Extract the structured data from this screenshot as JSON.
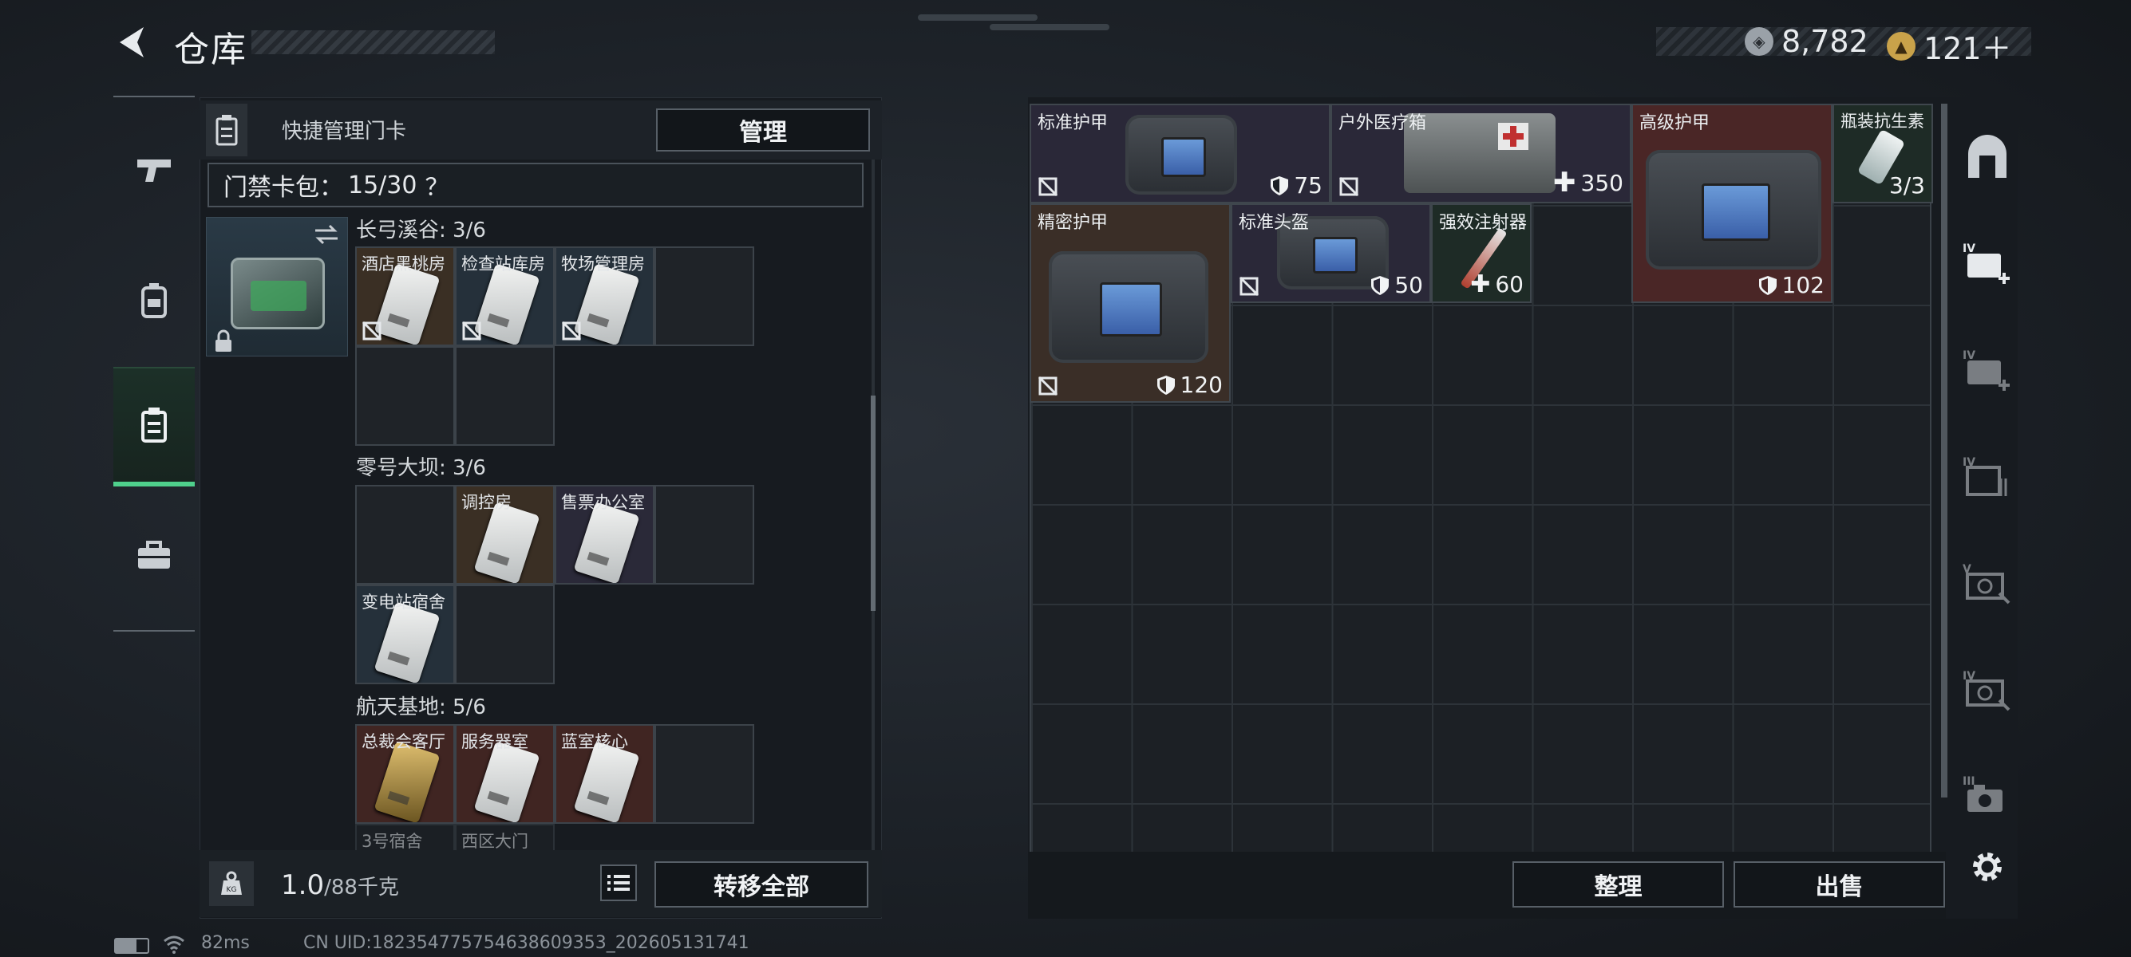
{
  "header": {
    "title": "仓库"
  },
  "currency": [
    {
      "icon": "silver-coin-icon",
      "value": "8,782"
    },
    {
      "icon": "gold-coin-icon",
      "value": "121＋"
    }
  ],
  "nav": {
    "items": [
      "weapon",
      "equipment",
      "keycard",
      "toolbox"
    ],
    "active": "keycard"
  },
  "quick_manage": {
    "label": "快捷管理门卡",
    "button": "管理"
  },
  "card_pack": {
    "label": "门禁卡包：",
    "count": "15/30",
    "help": "？"
  },
  "sections": [
    {
      "title": "长弓溪谷: 3/6",
      "cards": [
        "酒店黑桃房",
        "检查站库房",
        "牧场管理房"
      ]
    },
    {
      "title": "零号大坝: 3/6",
      "cards": [
        "调控房",
        "售票办公室",
        "变电站宿舍"
      ]
    },
    {
      "title": "航天基地: 5/6",
      "cards": [
        "总裁会客厅",
        "服务器室",
        "蓝室核心",
        "3号宿舍",
        "西区大门"
      ]
    }
  ],
  "weight": {
    "current": "1.0",
    "max": "/88千克"
  },
  "transfer_all": "转移全部",
  "items": [
    {
      "name": "标准护甲",
      "value": "75",
      "type": "armor"
    },
    {
      "name": "户外医疗箱",
      "value": "350",
      "type": "heal"
    },
    {
      "name": "高级护甲",
      "value": "102",
      "type": "armor"
    },
    {
      "name": "瓶装抗生素",
      "value": "3/3",
      "type": "stack"
    },
    {
      "name": "精密护甲",
      "value": "120",
      "type": "armor"
    },
    {
      "name": "标准头盔",
      "value": "50",
      "type": "armor"
    },
    {
      "name": "强效注射器",
      "value": "60",
      "type": "heal"
    }
  ],
  "actions": {
    "sort": "整理",
    "sell": "出售"
  },
  "status": {
    "ping": "82ms",
    "uid": "CN UID:1823547757546386093​53_202605131741"
  },
  "colors": {
    "accent_green": "#4fd08c",
    "armor_tint": "#3a2e27",
    "red_tint": "#4a2626"
  }
}
